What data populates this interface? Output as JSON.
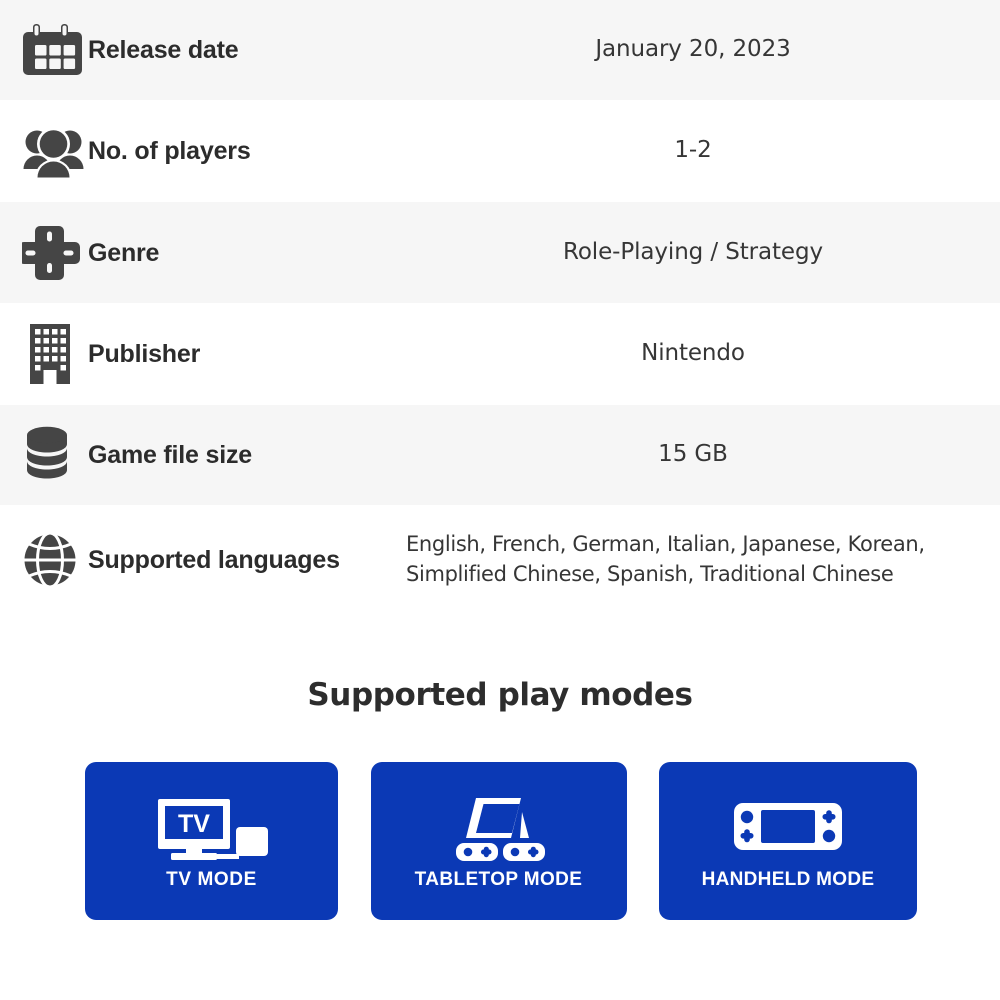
{
  "spec_table": {
    "rows": [
      {
        "icon": "calendar-icon",
        "label": "Release date",
        "value": "January 20, 2023"
      },
      {
        "icon": "players-group-icon",
        "label": "No. of players",
        "value": "1-2"
      },
      {
        "icon": "dpad-icon",
        "label": "Genre",
        "value": "Role-Playing / Strategy"
      },
      {
        "icon": "building-icon",
        "label": "Publisher",
        "value": "Nintendo"
      },
      {
        "icon": "database-icon",
        "label": "Game file size",
        "value": "15 GB"
      },
      {
        "icon": "globe-icon",
        "label": "Supported languages",
        "value": "English, French, German, Italian, Japanese, Korean, Simplified Chinese, Spanish, Traditional Chinese"
      }
    ]
  },
  "play_modes": {
    "title": "Supported play modes",
    "tile_color": "#0B39B5",
    "tile_text_color": "#FFFFFF",
    "tiles": [
      {
        "icon": "tv-dock-icon",
        "icon_text": "TV",
        "label": "TV MODE"
      },
      {
        "icon": "tabletop-console-icon",
        "label": "TABLETOP MODE"
      },
      {
        "icon": "handheld-console-icon",
        "label": "HANDHELD MODE"
      }
    ]
  },
  "colors": {
    "row_shade": "#F6F6F6",
    "row_plain": "#FFFFFF",
    "icon_color": "#454545",
    "label_color": "#2C2C2C",
    "value_color": "#363636"
  }
}
